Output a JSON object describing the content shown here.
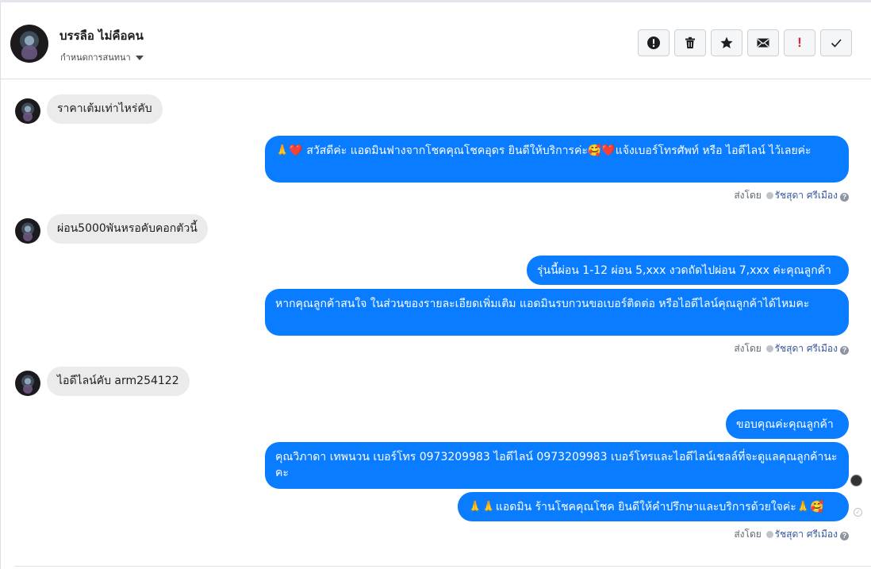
{
  "header": {
    "contact_name": "บรรลือ ไม่คือคน",
    "contact_sub": "กำหนดการสนทนา",
    "toolbar": [
      {
        "name": "spam-button",
        "icon": "exclamation-circle-icon"
      },
      {
        "name": "delete-button",
        "icon": "trash-icon"
      },
      {
        "name": "star-button",
        "icon": "star-icon"
      },
      {
        "name": "mark-unread-button",
        "icon": "envelope-icon"
      },
      {
        "name": "follow-up-button",
        "icon": "exclamation-icon",
        "label": "!"
      },
      {
        "name": "done-button",
        "icon": "check-icon"
      }
    ]
  },
  "messages": {
    "m1": "ราคาเต้มเท่าไหร่คับ",
    "m2": "🙏❤️ สวัสดีค่ะ แอดมินฟางจากโชคคุณโชคอุดร ยินดีให้บริการค่ะ🥰❤️แจ้งเบอร์โทรศัพท์ หรือ ไอดีไลน์  ไว้เลยค่ะ",
    "m3": "ผ่อน5000พันหรอคับคอกตัวนี้",
    "m4": "รุ่นนี้ผ่อน 1-12 ผ่อน 5,xxx งวดถัดไปผ่อน 7,xxx ค่ะคุณลูกค้า",
    "m5": "หากคุณลูกค้าสนใจ ในส่วนของรายละเอียดเพิ่มเติม แอดมินรบกวนขอเบอร์ติดต่อ หรือไอดีไลน์คุณลูกค้าได้ไหมคะ",
    "m6": "ไอดีไลน์คับ  arm254122",
    "m7": "ขอบคุณค่ะคุณลูกค้า",
    "m8": "คุณวิภาดา เทพนวน        เบอร์โทร 0973209983  ไอดีไลน์ 0973209983     เบอร์โทรและไอดีไลน์เชลล์ที่จะดูแลคุณลูกค้านะคะ",
    "m9": "🙏🙏แอดมิน ร้านโชคคุณโชค ยินดีให้คำปรึกษาและบริการด้วยใจค่ะ🙏🥰"
  },
  "sent_by": {
    "prefix": "ส่งโดย",
    "agent": "รัชสุดา ศรีเมือง",
    "help": "?"
  }
}
